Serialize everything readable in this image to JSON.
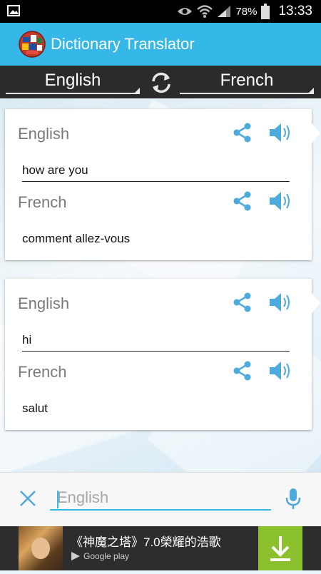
{
  "status_bar": {
    "battery": "78%",
    "time": "13:33"
  },
  "app": {
    "title": "Dictionary Translator"
  },
  "languages": {
    "source": "English",
    "target": "French"
  },
  "cards": [
    {
      "source_label": "English",
      "source_text": "how are you",
      "target_label": "French",
      "target_text": "comment allez-vous"
    },
    {
      "source_label": "English",
      "source_text": "hi",
      "target_label": "French",
      "target_text": "salut"
    }
  ],
  "input": {
    "placeholder": "English",
    "value": ""
  },
  "ad": {
    "title": "《神魔之塔》7.0榮耀的浩歌",
    "store_label": "Google play"
  },
  "colors": {
    "accent": "#35b7e8",
    "icon": "#4ea9dc",
    "ad_button": "#8bc12c"
  },
  "icons": [
    "gallery-icon",
    "eye-icon",
    "wifi-icon",
    "signal-icon",
    "battery-icon",
    "globe-logo-icon",
    "swap-icon",
    "share-icon",
    "speaker-icon",
    "clear-icon",
    "mic-icon",
    "play-store-icon",
    "download-icon"
  ]
}
